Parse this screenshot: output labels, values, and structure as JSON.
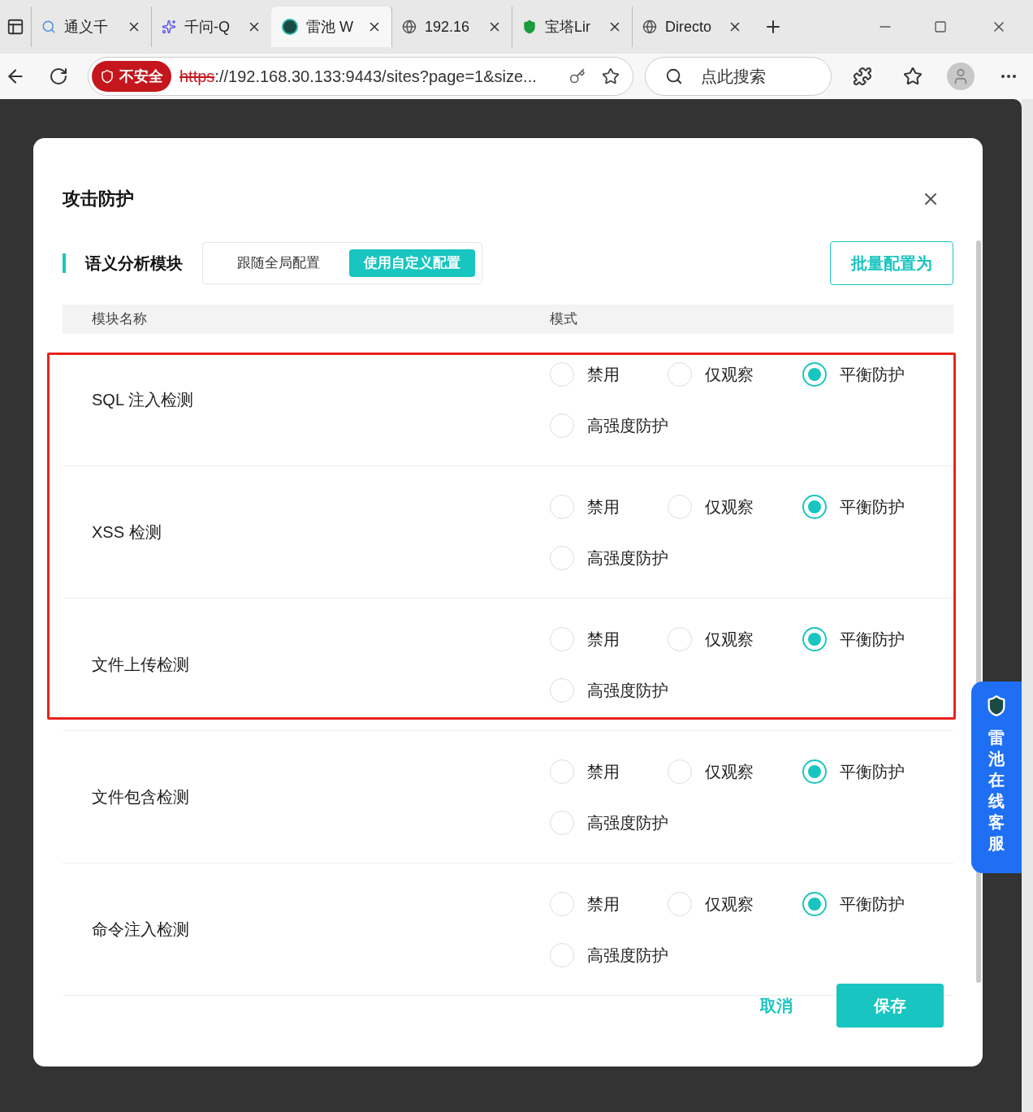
{
  "browser": {
    "tabs": [
      {
        "title": "通义千",
        "selected": false
      },
      {
        "title": "千问-Q",
        "selected": false
      },
      {
        "title": "雷池 W",
        "selected": true
      },
      {
        "title": "192.16",
        "selected": false
      },
      {
        "title": "宝塔Lir",
        "selected": false
      },
      {
        "title": "Directo",
        "selected": false
      }
    ],
    "security_badge": "不安全",
    "url_scheme": "https",
    "url_rest": "://192.168.30.133:9443/sites?page=1&size...",
    "search_placeholder": "点此搜索"
  },
  "dialog": {
    "title": "攻击防护",
    "section_title": "语义分析模块",
    "config_modes": [
      {
        "label": "跟随全局配置",
        "selected": false
      },
      {
        "label": "使用自定义配置",
        "selected": true
      }
    ],
    "batch_button": "批量配置为",
    "columns": [
      "模块名称",
      "模式"
    ],
    "rows": [
      {
        "name": "SQL 注入检测",
        "highlighted": true,
        "options": [
          {
            "label": "禁用",
            "selected": false
          },
          {
            "label": "仅观察",
            "selected": false
          },
          {
            "label": "平衡防护",
            "selected": true
          },
          {
            "label": "高强度防护",
            "selected": false
          }
        ]
      },
      {
        "name": "XSS 检测",
        "highlighted": true,
        "options": [
          {
            "label": "禁用",
            "selected": false
          },
          {
            "label": "仅观察",
            "selected": false
          },
          {
            "label": "平衡防护",
            "selected": true
          },
          {
            "label": "高强度防护",
            "selected": false
          }
        ]
      },
      {
        "name": "文件上传检测",
        "highlighted": true,
        "options": [
          {
            "label": "禁用",
            "selected": false
          },
          {
            "label": "仅观察",
            "selected": false
          },
          {
            "label": "平衡防护",
            "selected": true
          },
          {
            "label": "高强度防护",
            "selected": false
          }
        ]
      },
      {
        "name": "文件包含检测",
        "highlighted": false,
        "options": [
          {
            "label": "禁用",
            "selected": false
          },
          {
            "label": "仅观察",
            "selected": false
          },
          {
            "label": "平衡防护",
            "selected": true
          },
          {
            "label": "高强度防护",
            "selected": false
          }
        ]
      },
      {
        "name": "命令注入检测",
        "highlighted": false,
        "options": [
          {
            "label": "禁用",
            "selected": false
          },
          {
            "label": "仅观察",
            "selected": false
          },
          {
            "label": "平衡防护",
            "selected": true
          },
          {
            "label": "高强度防护",
            "selected": false
          }
        ]
      }
    ],
    "cancel": "取消",
    "save": "保存"
  },
  "support_widget": "雷池在线客服"
}
